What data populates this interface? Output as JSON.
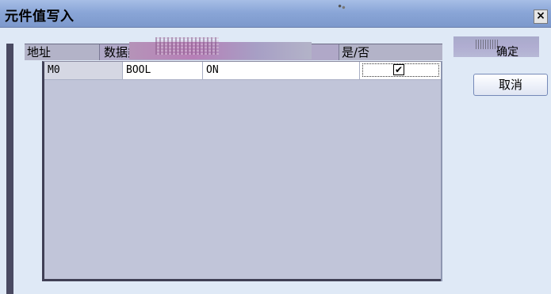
{
  "window": {
    "title": "元件值写入",
    "close_label": "×"
  },
  "table": {
    "columns": [
      "地址",
      "数据类型",
      "是/否"
    ],
    "rows": [
      {
        "address": "M0",
        "data_type": "BOOL",
        "value": "ON",
        "checked_mark": "✔"
      }
    ]
  },
  "buttons": {
    "ok_label": "确定",
    "cancel_label": "取消"
  }
}
